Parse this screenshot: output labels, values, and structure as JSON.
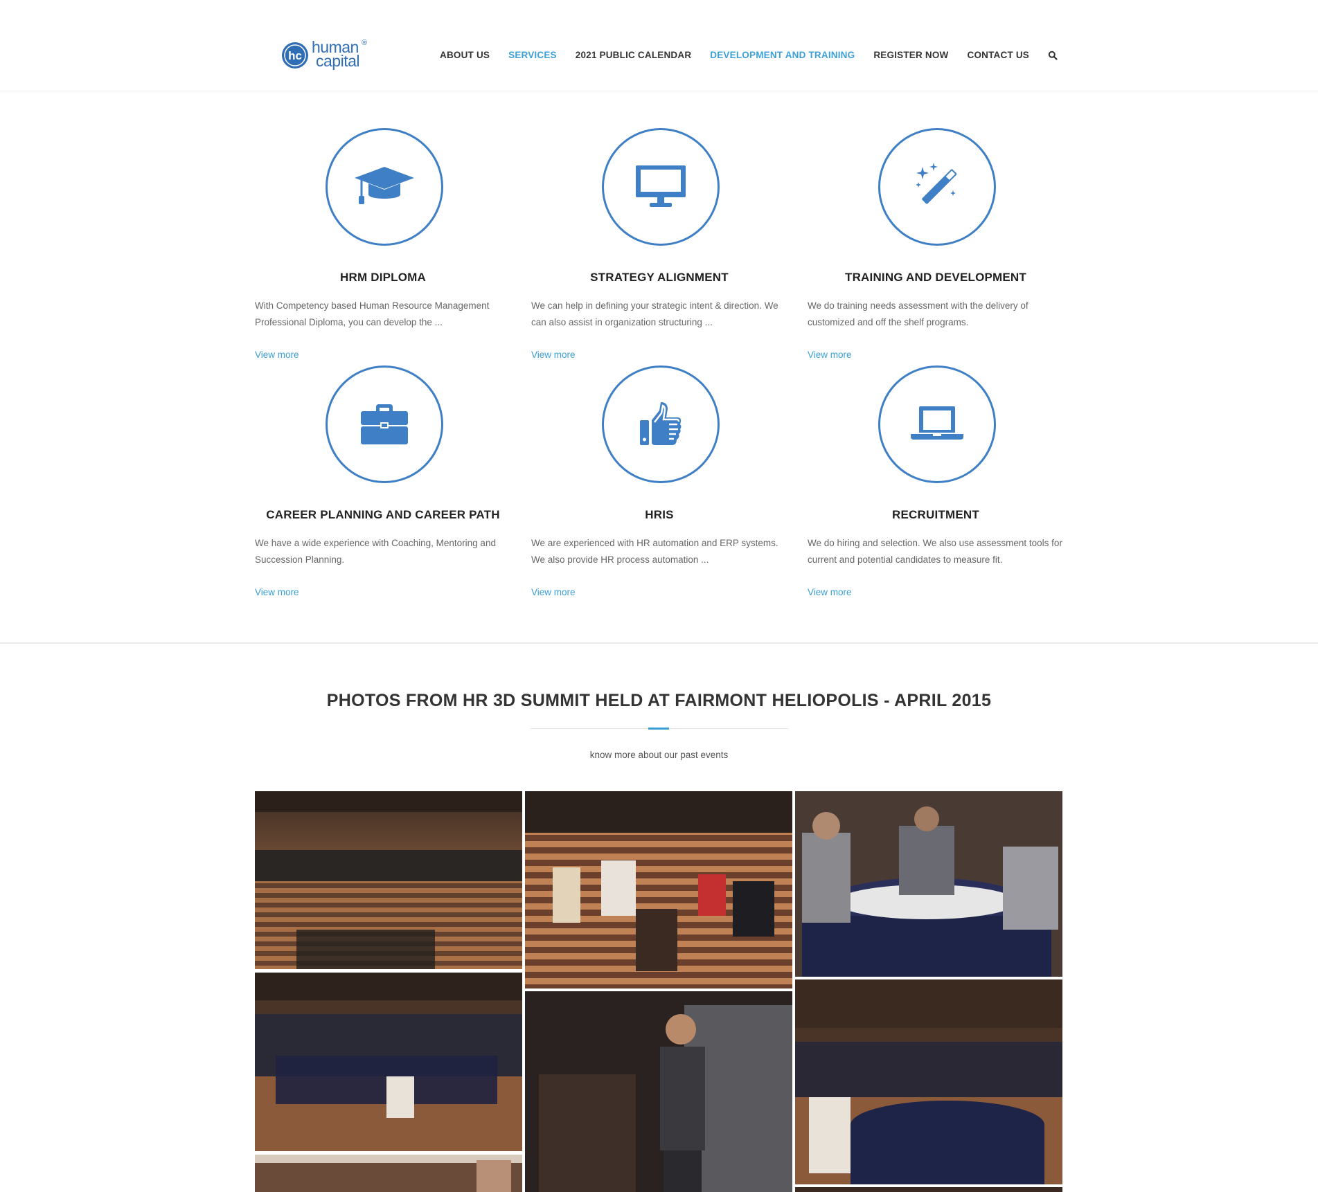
{
  "brand": {
    "logo_monogram": "hc",
    "logo_line1": "human",
    "logo_line2": "capital",
    "logo_mark": "®",
    "primary_color": "#3f7fc5",
    "link_color": "#3ba0d8"
  },
  "nav": {
    "items": [
      {
        "label": "ABOUT US",
        "active": false
      },
      {
        "label": "SERVICES",
        "active": true
      },
      {
        "label": "2021 PUBLIC CALENDAR",
        "active": false
      },
      {
        "label": "DEVELOPMENT AND TRAINING",
        "active": true
      },
      {
        "label": "REGISTER NOW",
        "active": false
      },
      {
        "label": "CONTACT US",
        "active": false
      }
    ],
    "search_icon": "search-icon"
  },
  "services": [
    {
      "icon": "graduation-cap-icon",
      "title": "HRM DIPLOMA",
      "desc1": "With Competency based Human Resource Management",
      "desc2": "Professional Diploma, you can develop the ...",
      "more": "View more"
    },
    {
      "icon": "monitor-icon",
      "title": "STRATEGY ALIGNMENT",
      "desc1": "We can help in defining your strategic intent & direction. We",
      "desc2": "can also assist in organization structuring ...",
      "more": "View more"
    },
    {
      "icon": "magic-wand-icon",
      "title": "TRAINING AND DEVELOPMENT",
      "desc1": "We do training needs assessment with the delivery of",
      "desc2": "customized and off the shelf programs.",
      "more": "View more"
    },
    {
      "icon": "briefcase-icon",
      "title": "CAREER PLANNING AND CAREER PATH",
      "desc1": "We have a wide experience with Coaching, Mentoring and",
      "desc2": "Succession Planning.",
      "more": "View more"
    },
    {
      "icon": "thumbs-up-icon",
      "title": "HRIS",
      "desc1": "We are experienced with HR automation and ERP systems.",
      "desc2": "We also provide HR process automation ...",
      "more": "View more"
    },
    {
      "icon": "laptop-icon",
      "title": "RECRUITMENT",
      "desc1": "We do hiring and selection. We also use assessment tools for",
      "desc2": "current and potential candidates to measure fit.",
      "more": "View more"
    }
  ],
  "gallery": {
    "title": "PHOTOS FROM HR 3D SUMMIT HELD AT FAIRMONT HELIOPOLIS - APRIL 2015",
    "subtitle": "know more about our past events"
  }
}
